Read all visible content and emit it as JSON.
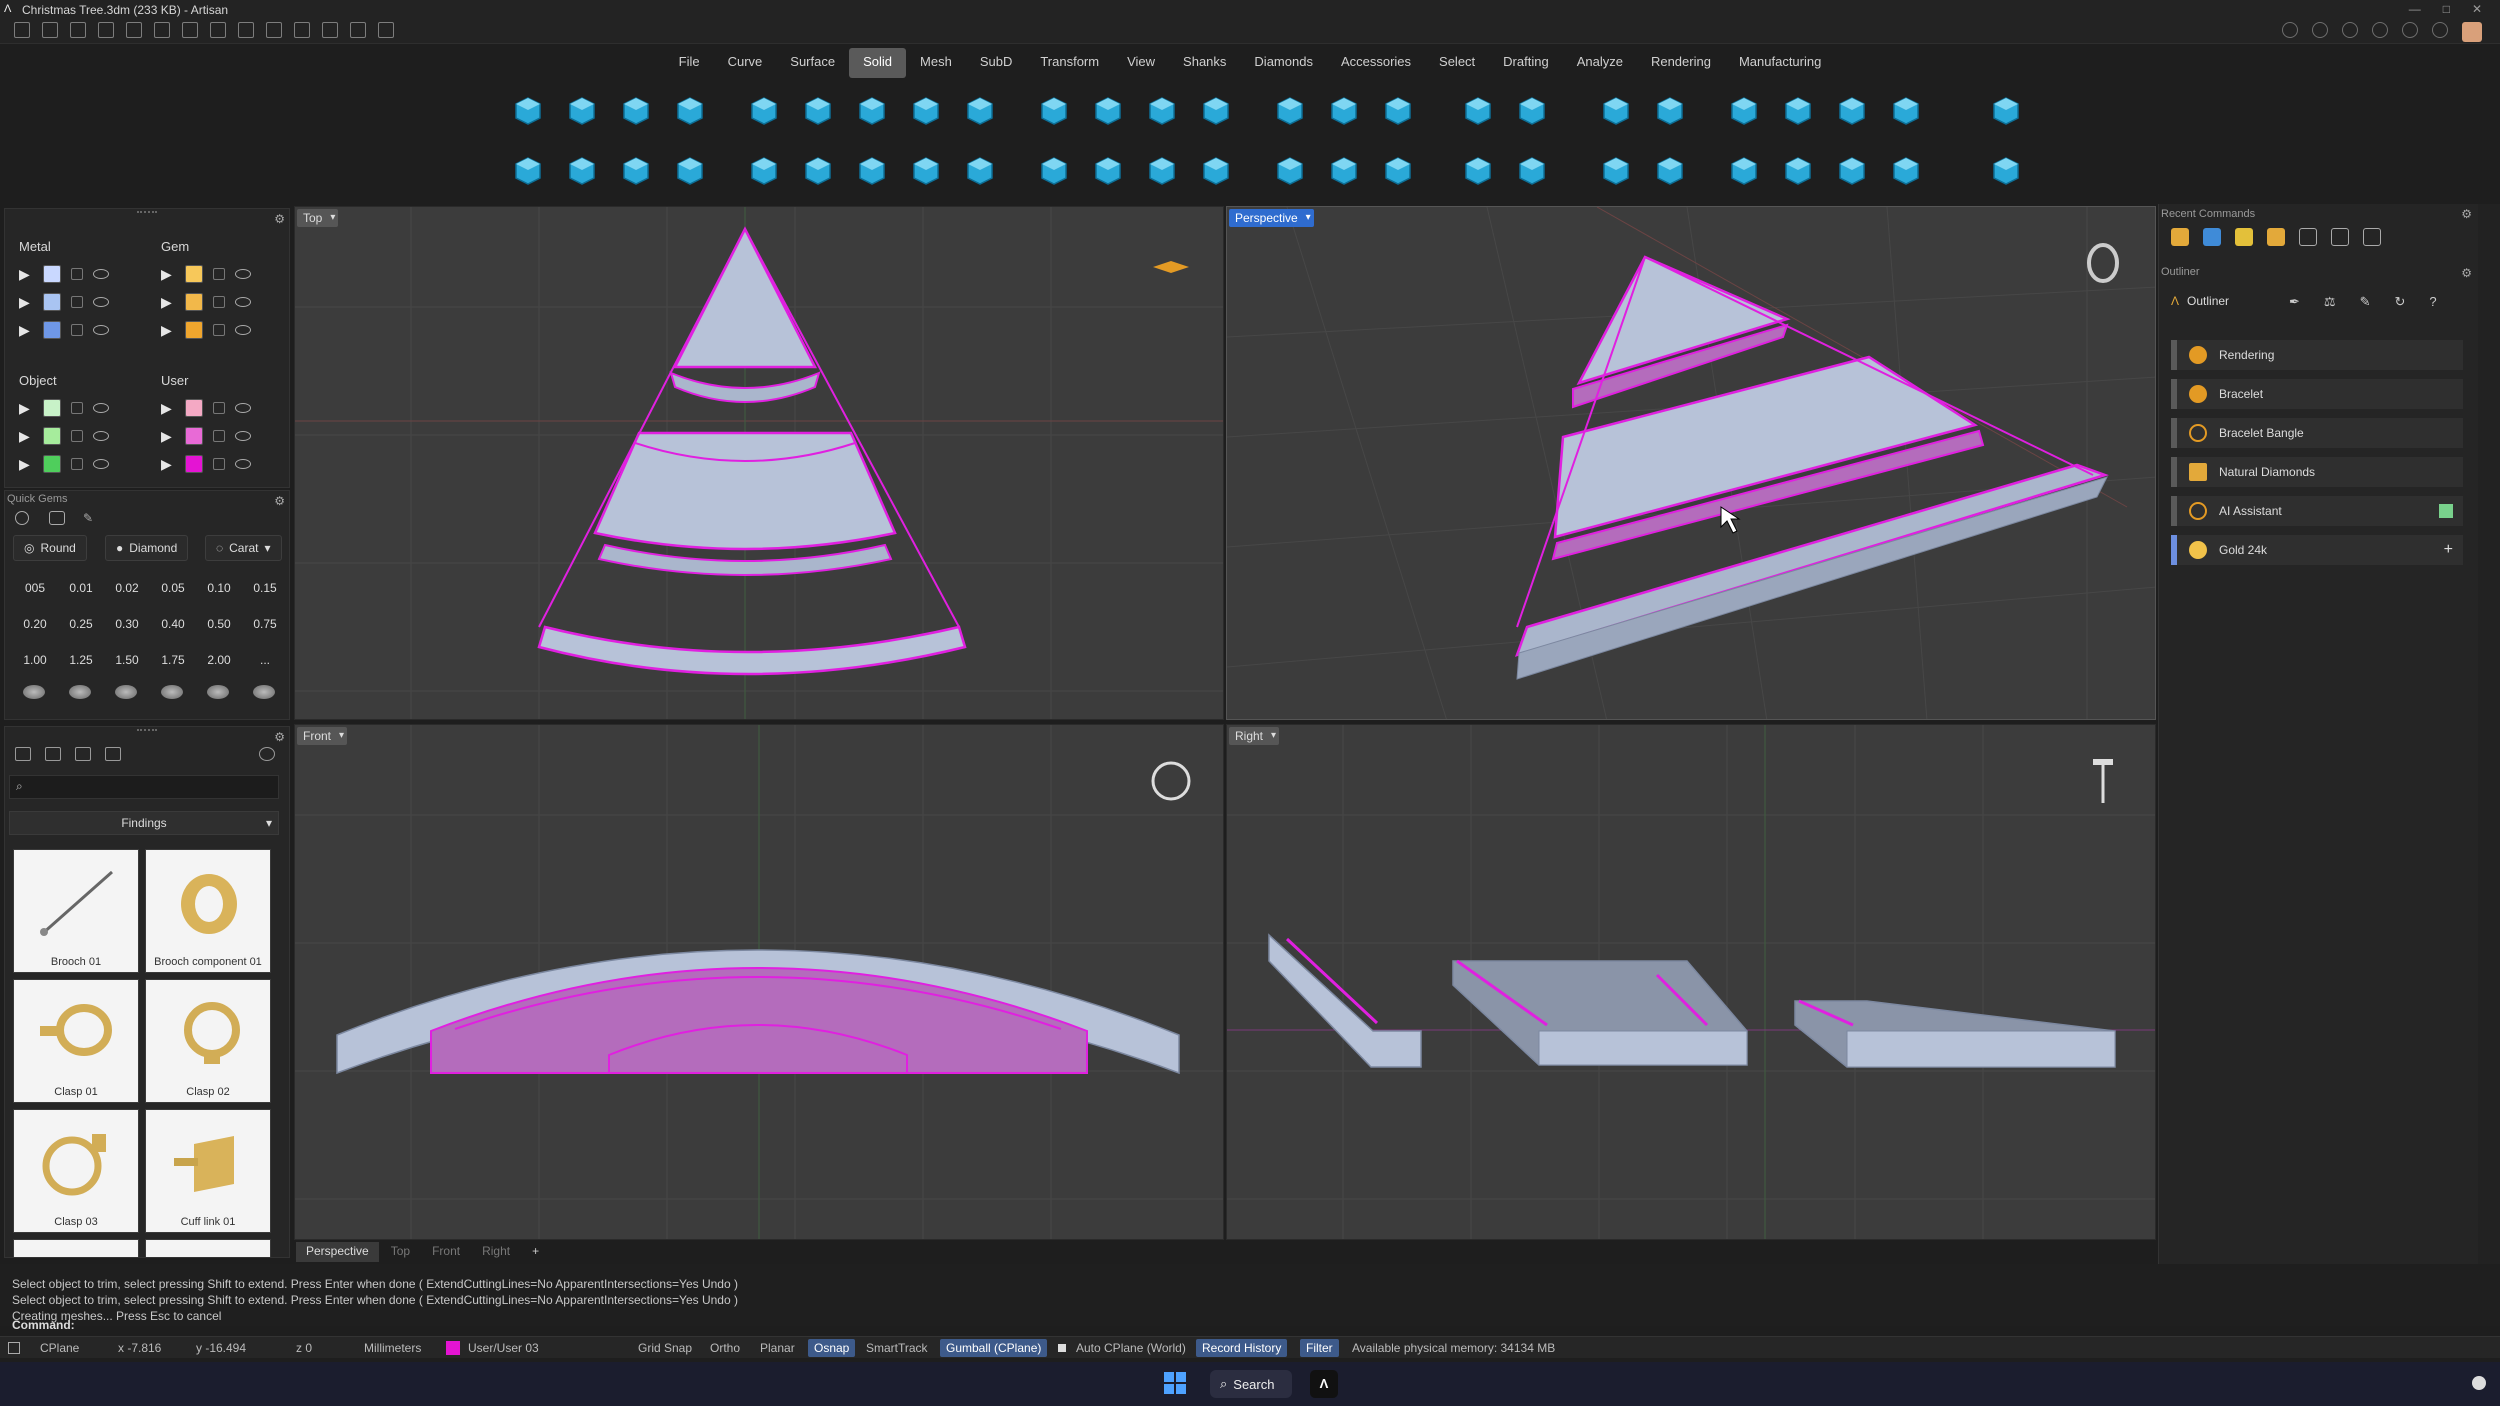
{
  "titlebar": {
    "title": "Christmas Tree.3dm (233 KB) - Artisan",
    "window_controls": [
      "—",
      "□",
      "✕"
    ]
  },
  "menu": [
    "File",
    "Curve",
    "Surface",
    "Solid",
    "Mesh",
    "SubD",
    "Transform",
    "View",
    "Shanks",
    "Diamonds",
    "Accessories",
    "Select",
    "Drafting",
    "Analyze",
    "Rendering",
    "Manufacturing"
  ],
  "active_menu": "Solid",
  "layers": {
    "metal": "Metal",
    "gem": "Gem",
    "object": "Object",
    "user": "User",
    "metal_colors": [
      "#c9d8ff",
      "#a9c4f2",
      "#6f97e6"
    ],
    "gem_colors": [
      "#f7c85a",
      "#f2b84a",
      "#f0a62e"
    ],
    "object_colors": [
      "#c8f2c8",
      "#a6ec9c",
      "#4fce5c"
    ],
    "user_colors": [
      "#f4a9c4",
      "#e86ad6",
      "#e414d3"
    ]
  },
  "quick_gems": {
    "title": "Quick Gems",
    "shape": "Round",
    "cut": "Diamond",
    "unit": "Carat",
    "sizes": [
      "005",
      "0.01",
      "0.02",
      "0.05",
      "0.10",
      "0.15",
      "0.20",
      "0.25",
      "0.30",
      "0.40",
      "0.50",
      "0.75",
      "1.00",
      "1.25",
      "1.50",
      "1.75",
      "2.00",
      "..."
    ]
  },
  "library": {
    "category": "Findings",
    "items": [
      "Brooch 01",
      "Brooch component 01",
      "Clasp 01",
      "Clasp 02",
      "Clasp 03",
      "Cuff link 01"
    ]
  },
  "viewports": {
    "top": "Top",
    "perspective": "Perspective",
    "front": "Front",
    "right": "Right"
  },
  "viewport_tabs": [
    "Perspective",
    "Top",
    "Front",
    "Right",
    "+"
  ],
  "right_panel": {
    "recent_title": "Recent Commands",
    "outliner_title": "Outliner",
    "outliner_label": "Outliner",
    "items": [
      "Rendering",
      "Bracelet",
      "Bracelet Bangle",
      "Natural Diamonds",
      "AI Assistant",
      "Gold 24k"
    ]
  },
  "command_history": [
    "Select object to trim, select pressing Shift to extend. Press Enter when done ( ExtendCuttingLines=No  ApparentIntersections=Yes  Undo )",
    "Select object to trim, select pressing Shift to extend. Press Enter when done ( ExtendCuttingLines=No  ApparentIntersections=Yes  Undo )",
    "Creating meshes... Press Esc to cancel"
  ],
  "command_prompt": "Command:",
  "status": {
    "cplane": "CPlane",
    "x": "x -7.816",
    "y": "y -16.494",
    "z": "z 0",
    "units": "Millimeters",
    "layer": "User/User 03",
    "grid_snap": "Grid Snap",
    "ortho": "Ortho",
    "planar": "Planar",
    "osnap": "Osnap",
    "smarttrack": "SmartTrack",
    "gumball": "Gumball (CPlane)",
    "auto_cplane": "Auto CPlane (World)",
    "record_history": "Record History",
    "filter": "Filter",
    "memory": "Available physical memory: 34134 MB"
  },
  "taskbar": {
    "search": "Search"
  }
}
